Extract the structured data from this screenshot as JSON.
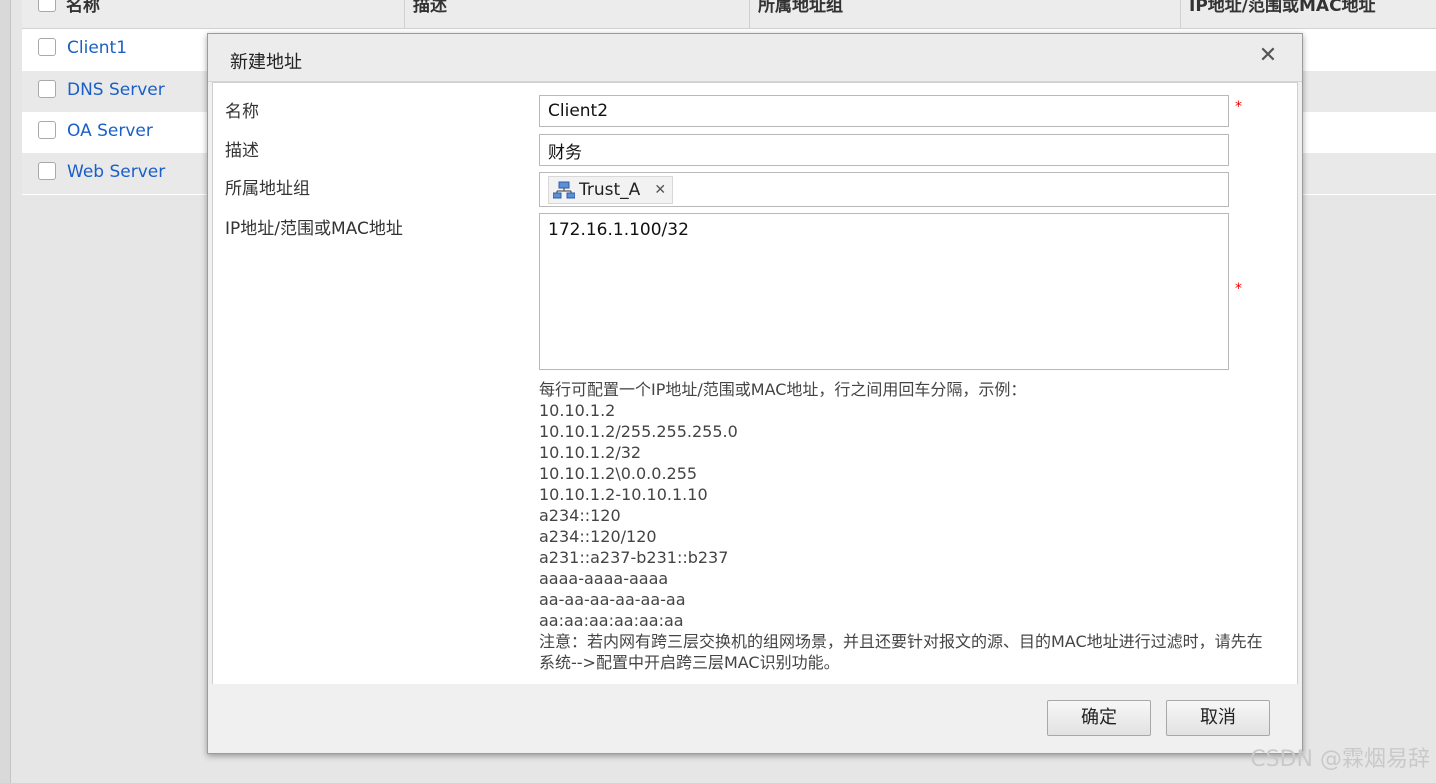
{
  "background_table": {
    "columns": [
      "名称",
      "描述",
      "所属地址组",
      "IP地址/范围或MAC地址"
    ],
    "rows": [
      {
        "name": "Client1"
      },
      {
        "name": "DNS Server"
      },
      {
        "name": "OA Server"
      },
      {
        "name": "Web Server"
      }
    ]
  },
  "dialog": {
    "title": "新建地址",
    "close_icon": "close-icon",
    "fields": {
      "name": {
        "label": "名称",
        "value": "Client2",
        "required": "*"
      },
      "description": {
        "label": "描述",
        "value": "财务"
      },
      "group": {
        "label": "所属地址组",
        "tag": "Trust_A",
        "tag_icon": "network-group-icon"
      },
      "ip": {
        "label": "IP地址/范围或MAC地址",
        "value": "172.16.1.100/32",
        "required": "*"
      }
    },
    "hint": {
      "intro": "每行可配置一个IP地址/范围或MAC地址，行之间用回车分隔，示例：",
      "examples": [
        "10.10.1.2",
        "10.10.1.2/255.255.255.0",
        "10.10.1.2/32",
        "10.10.1.2\\0.0.0.255",
        "10.10.1.2-10.10.1.10",
        "a234::120",
        "a234::120/120",
        "a231::a237-b231::b237",
        "aaaa-aaaa-aaaa",
        "aa-aa-aa-aa-aa-aa",
        "aa:aa:aa:aa:aa:aa"
      ],
      "note": "注意：若内网有跨三层交换机的组网场景，并且还要针对报文的源、目的MAC地址进行过滤时，请先在系统-->配置中开启跨三层MAC识别功能。"
    },
    "buttons": {
      "ok": "确定",
      "cancel": "取消"
    }
  },
  "watermark": "CSDN @霖烟易辞"
}
